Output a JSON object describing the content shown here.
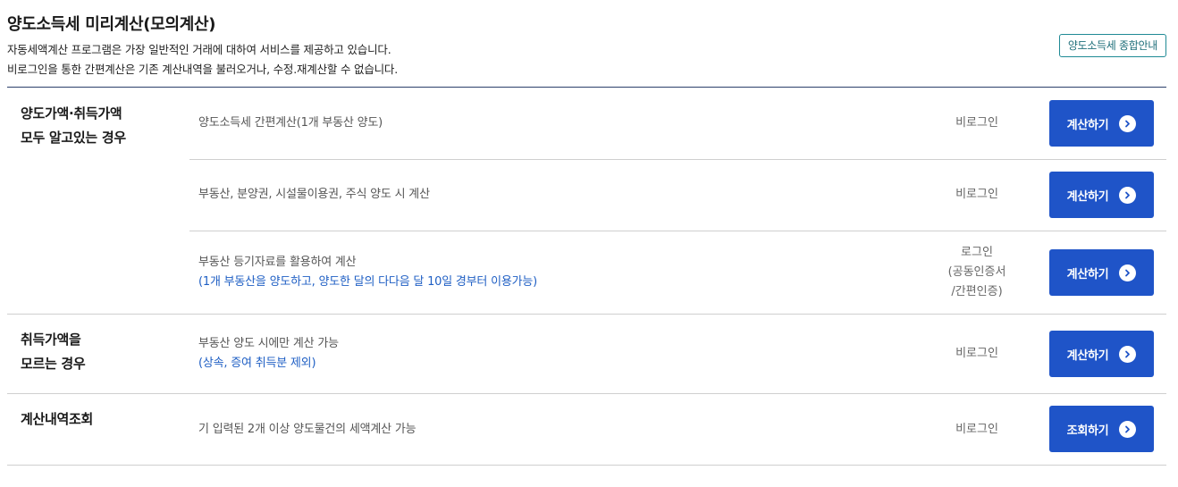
{
  "header": {
    "title": "양도소득세 미리계산(모의계산)",
    "description_line1": "자동세액계산 프로그램은 가장 일반적인 거래에 대하여 서비스를 제공하고 있습니다.",
    "description_line2": "비로그인을 통한 간편계산은 기존 계산내역을 불러오거나, 수정.재계산할 수 없습니다.",
    "guide_button_label": "양도소득세 종합안내"
  },
  "groups": [
    {
      "label_line1": "양도가액·취득가액",
      "label_line2": "모두 알고있는 경우",
      "rows": [
        {
          "description": "양도소득세 간편계산(1개 부동산 양도)",
          "login": "비로그인",
          "button_label": "계산하기"
        },
        {
          "description": "부동산, 분양권, 시설물이용권, 주식 양도 시 계산",
          "login": "비로그인",
          "button_label": "계산하기"
        },
        {
          "description": "부동산 등기자료를 활용하여 계산",
          "note": "(1개 부동산을 양도하고, 양도한 달의 다다음 달 10일 경부터 이용가능)",
          "login_line1": "로그인",
          "login_line2": "(공동인증서",
          "login_line3": "/간편인증)",
          "button_label": "계산하기"
        }
      ]
    },
    {
      "label_line1": "취득가액을",
      "label_line2": "모르는 경우",
      "rows": [
        {
          "description": "부동산 양도 시에만 계산 가능",
          "note": "(상속, 증여 취득분 제외)",
          "login": "비로그인",
          "button_label": "계산하기"
        }
      ]
    },
    {
      "label_line1": "계산내역조회",
      "rows": [
        {
          "description": "기 입력된 2개 이상 양도물건의 세액계산 가능",
          "login": "비로그인",
          "button_label": "조회하기"
        }
      ]
    }
  ],
  "icons": {
    "button_arrow": "chevron-right-circle-icon"
  },
  "colors": {
    "button_bg": "#1f54c8",
    "note_text": "#1f5fc4",
    "guide_border": "#1f8a95",
    "top_rule": "#2b3f6b"
  }
}
